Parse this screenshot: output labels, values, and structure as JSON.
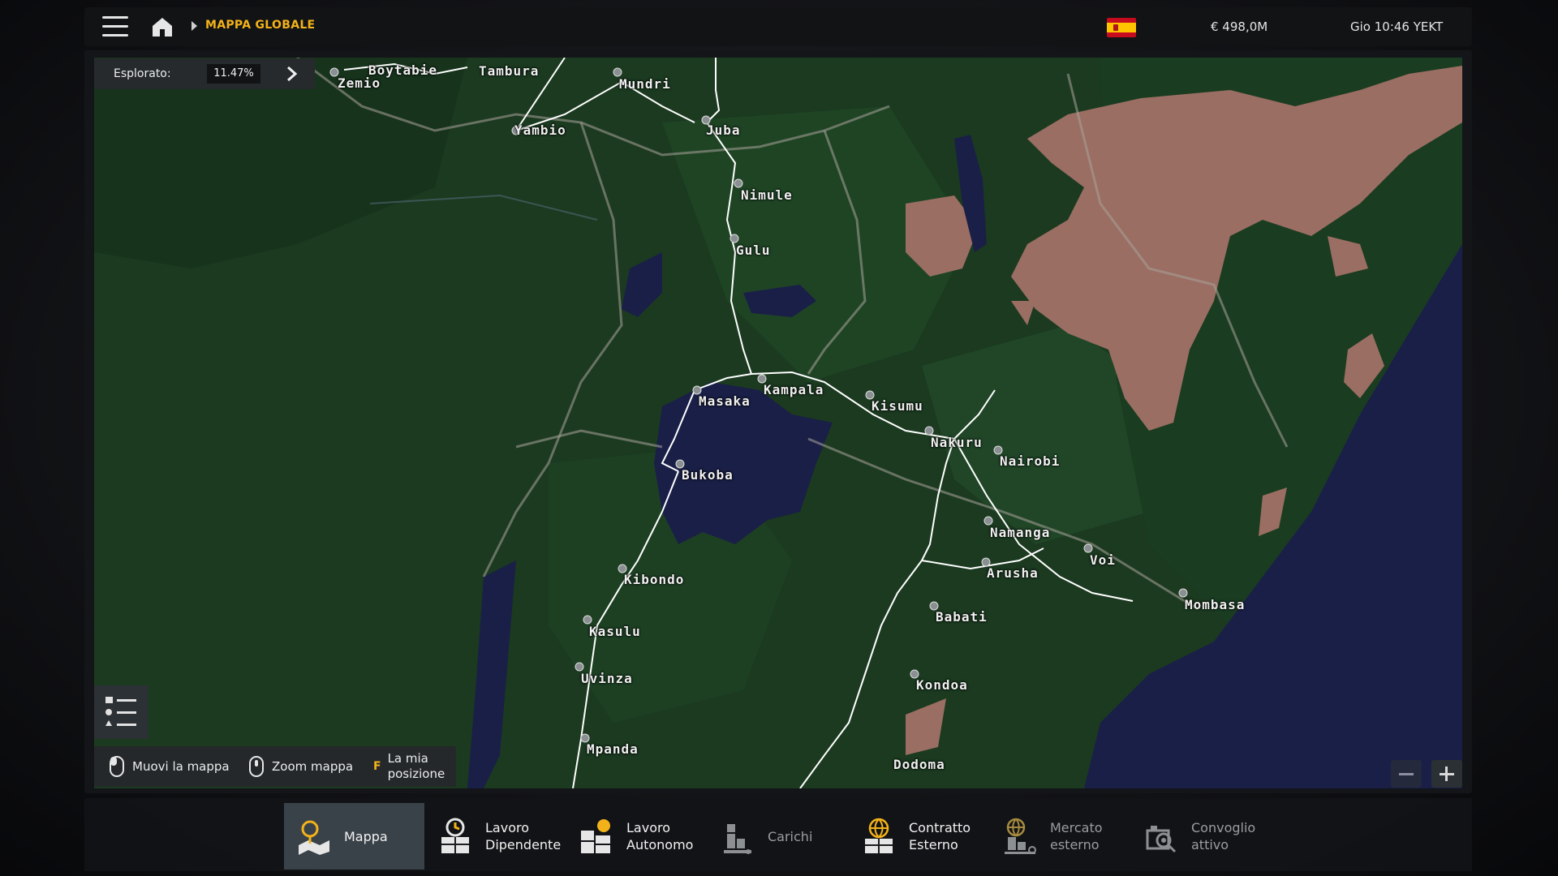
{
  "topbar": {
    "breadcrumb": "MAPPA GLOBALE",
    "money": "€ 498,0M",
    "clock": "Gio 10:46 YEKT",
    "flag_icon": "spain-flag-icon"
  },
  "explored": {
    "label": "Esplorato:",
    "value": "11.47%"
  },
  "cities": [
    {
      "name": "Zemio"
    },
    {
      "name": "Boytabie"
    },
    {
      "name": "Tambura"
    },
    {
      "name": "Mundri"
    },
    {
      "name": "Yambio"
    },
    {
      "name": "Juba"
    },
    {
      "name": "Nimule"
    },
    {
      "name": "Gulu"
    },
    {
      "name": "Kampala"
    },
    {
      "name": "Masaka"
    },
    {
      "name": "Kisumu"
    },
    {
      "name": "Nakuru"
    },
    {
      "name": "Nairobi"
    },
    {
      "name": "Bukoba"
    },
    {
      "name": "Namanga"
    },
    {
      "name": "Voi"
    },
    {
      "name": "Arusha"
    },
    {
      "name": "Mombasa"
    },
    {
      "name": "Kibondo"
    },
    {
      "name": "Kasulu"
    },
    {
      "name": "Babati"
    },
    {
      "name": "Uvinza"
    },
    {
      "name": "Kondoa"
    },
    {
      "name": "Mpanda"
    },
    {
      "name": "Dodoma"
    }
  ],
  "hints": {
    "move": "Muovi la mappa",
    "zoom": "Zoom mappa",
    "key": "F",
    "position_line1": "La mia",
    "position_line2": "posizione"
  },
  "tabs": [
    {
      "line1": "Mappa",
      "line2": "",
      "icon": "map-icon"
    },
    {
      "line1": "Lavoro",
      "line2": "Dipendente",
      "icon": "job-clock-icon"
    },
    {
      "line1": "Lavoro",
      "line2": "Autonomo",
      "icon": "freelance-icon"
    },
    {
      "line1": "Carichi",
      "line2": "",
      "icon": "cargo-icon"
    },
    {
      "line1": "Contratto",
      "line2": "Esterno",
      "icon": "globe-contract-icon"
    },
    {
      "line1": "Mercato",
      "line2": "esterno",
      "icon": "external-market-icon"
    },
    {
      "line1": "Convoglio",
      "line2": "attivo",
      "icon": "convoy-icon"
    }
  ],
  "colors": {
    "accent": "#f3b21a",
    "land": "#1b3a20",
    "water": "#1a1f47",
    "desert": "#9a6e62",
    "road": "#ffffff"
  }
}
